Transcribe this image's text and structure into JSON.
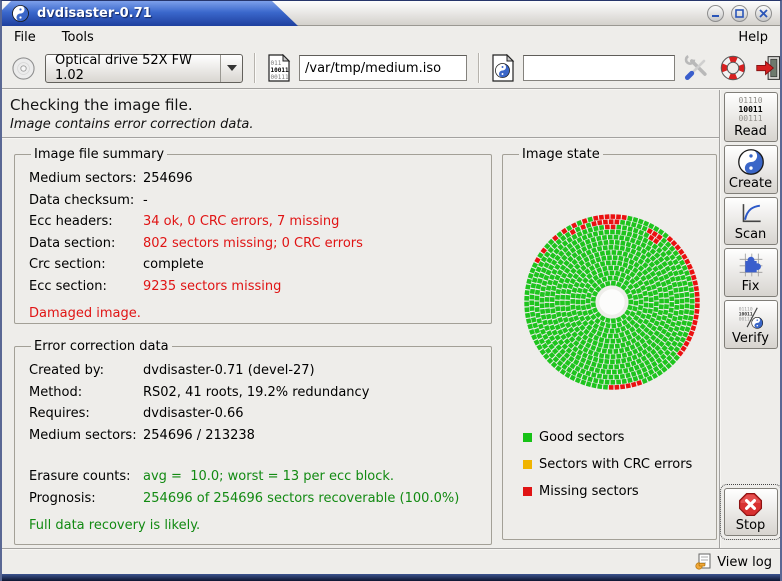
{
  "window": {
    "title": "dvdisaster-0.71"
  },
  "menubar": {
    "file": "File",
    "tools": "Tools",
    "help": "Help"
  },
  "toolbar": {
    "drive_label": "Optical drive 52X FW 1.02",
    "image_file_value": "/var/tmp/medium.iso",
    "ecc_file_value": ""
  },
  "heading": {
    "title": "Checking the image file.",
    "subtitle": "Image contains error correction data."
  },
  "image_file_summary": {
    "title": "Image file summary",
    "rows": [
      {
        "label": "Medium sectors:",
        "value": "254696",
        "color": "#000000"
      },
      {
        "label": "Data checksum:",
        "value": "-",
        "color": "#000000"
      },
      {
        "label": "Ecc headers:",
        "value": "34 ok, 0 CRC errors, 7 missing",
        "color": "#e01414"
      },
      {
        "label": "Data section:",
        "value": "802 sectors missing; 0 CRC errors",
        "color": "#e01414"
      },
      {
        "label": "Crc section:",
        "value": "complete",
        "color": "#000000"
      },
      {
        "label": "Ecc section:",
        "value": "9235 sectors missing",
        "color": "#e01414"
      }
    ],
    "footer": {
      "text": "Damaged image.",
      "color": "#e01414"
    }
  },
  "error_correction_data": {
    "title": "Error correction data",
    "rows": [
      {
        "label": "Created by:",
        "value": "dvdisaster-0.71 (devel-27)",
        "color": "#000000"
      },
      {
        "label": "Method:",
        "value": "RS02, 41 roots, 19.2% redundancy",
        "color": "#000000"
      },
      {
        "label": "Requires:",
        "value": "dvdisaster-0.66",
        "color": "#000000"
      },
      {
        "label": "Medium sectors:",
        "value": "254696 / 213238",
        "color": "#000000"
      }
    ],
    "rows2": [
      {
        "label": "Erasure counts:",
        "value": "avg =  10.0; worst = 13 per ecc block.",
        "color": "#128a12"
      },
      {
        "label": "Prognosis:",
        "value": "254696 of 254696 sectors recoverable (100.0%)",
        "color": "#128a12"
      }
    ],
    "footer": {
      "text": "Full data recovery is likely.",
      "color": "#128a12"
    }
  },
  "image_state": {
    "title": "Image state",
    "legend": [
      {
        "label": "Good sectors",
        "color": "#17c217"
      },
      {
        "label": "Sectors with CRC errors",
        "color": "#f0b400"
      },
      {
        "label": "Missing sectors",
        "color": "#e01414"
      }
    ]
  },
  "sidebar": {
    "read": "Read",
    "create": "Create",
    "scan": "Scan",
    "fix": "Fix",
    "verify": "Verify",
    "stop": "Stop",
    "read_icon_lines": [
      "01110",
      "10011",
      "00111"
    ]
  },
  "statusbar": {
    "view_log": "View log"
  },
  "chart_data": {
    "type": "disc-sector-map",
    "title": "Image state",
    "description": "DVD image sector map: concentric rings of sector blocks, green = good, red = missing",
    "rings": 14,
    "inner_radius": 20,
    "ring_spacing": 5.45,
    "block_size": 4.9,
    "tangential_step": 6.1,
    "colors": {
      "good": "#1ec41e",
      "crc": "#f0b400",
      "missing": "#ea1111"
    },
    "missing_segments": [
      [
        13,
        -38,
        50
      ],
      [
        13,
        80,
        104
      ],
      [
        13,
        108,
        111
      ],
      [
        13,
        115,
        118
      ],
      [
        13,
        122,
        125
      ],
      [
        13,
        129,
        132
      ],
      [
        13,
        136,
        139
      ],
      [
        13,
        143,
        146
      ],
      [
        13,
        150,
        153
      ],
      [
        13,
        266,
        290
      ],
      [
        12,
        84,
        106
      ],
      [
        12,
        52,
        64
      ],
      [
        12,
        110,
        113
      ],
      [
        12,
        118,
        121
      ],
      [
        11,
        54,
        62
      ],
      [
        11,
        88,
        94
      ]
    ]
  }
}
